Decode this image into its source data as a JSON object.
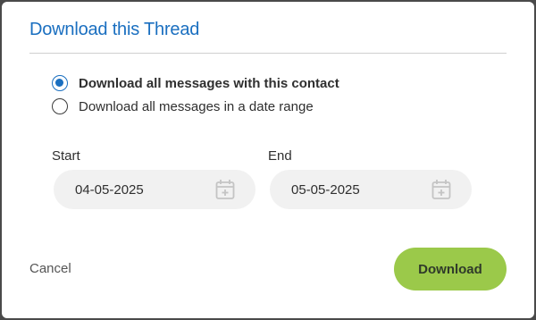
{
  "dialog": {
    "title": "Download this Thread",
    "options": [
      {
        "label": "Download all messages with this contact",
        "selected": true
      },
      {
        "label": "Download all messages in a date range",
        "selected": false
      }
    ],
    "start": {
      "label": "Start",
      "value": "04-05-2025",
      "icon": "calendar-plus-icon"
    },
    "end": {
      "label": "End",
      "value": "05-05-2025",
      "icon": "calendar-plus-icon"
    },
    "cancel_label": "Cancel",
    "download_label": "Download"
  },
  "colors": {
    "accent": "#1a6fc0",
    "download_button": "#9bc94a",
    "field_bg": "#f1f1f1",
    "backdrop": "#4a4a4a"
  }
}
